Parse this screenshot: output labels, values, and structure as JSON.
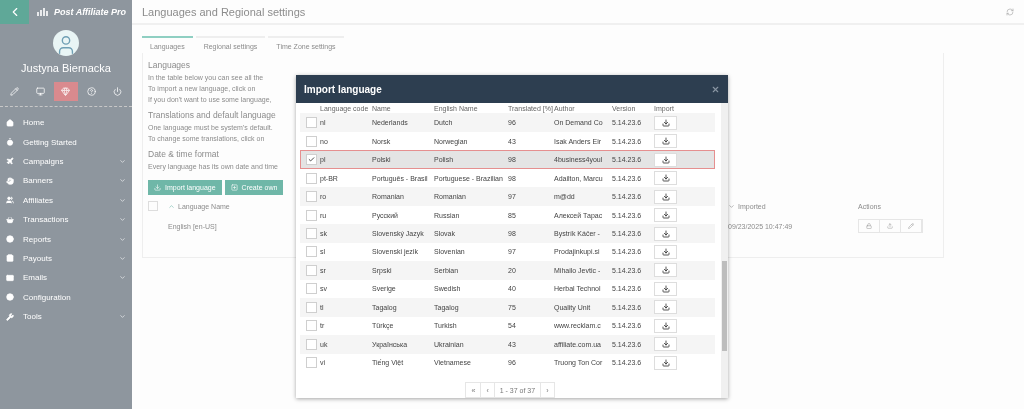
{
  "sidebar": {
    "logo": "Post Affiliate Pro",
    "user_name": "Justyna Biernacka",
    "tools": [
      {
        "selected": false
      },
      {
        "selected": false
      },
      {
        "selected": true
      },
      {
        "selected": false
      },
      {
        "selected": false
      }
    ],
    "items": [
      {
        "label": "Home",
        "has_submenu": false
      },
      {
        "label": "Getting Started",
        "has_submenu": false
      },
      {
        "label": "Campaigns",
        "has_submenu": true
      },
      {
        "label": "Banners",
        "has_submenu": true
      },
      {
        "label": "Affiliates",
        "has_submenu": true
      },
      {
        "label": "Transactions",
        "has_submenu": true
      },
      {
        "label": "Reports",
        "has_submenu": true
      },
      {
        "label": "Payouts",
        "has_submenu": true
      },
      {
        "label": "Emails",
        "has_submenu": true
      },
      {
        "label": "Configuration",
        "has_submenu": false
      },
      {
        "label": "Tools",
        "has_submenu": true
      }
    ]
  },
  "page": {
    "title": "Languages and Regional settings",
    "tabs": [
      {
        "label": "Languages",
        "selected": true
      },
      {
        "label": "Regional settings",
        "selected": false
      },
      {
        "label": "Time Zone settings",
        "selected": false
      }
    ],
    "sections": [
      {
        "heading": "Languages",
        "lines": [
          "In the table below you can see all the",
          "To import a new language, click on",
          "If you don't want to use some language,"
        ]
      },
      {
        "heading": "Translations and default language",
        "lines": [
          "One language must be system's default.",
          "To change some translations, click on"
        ]
      },
      {
        "heading": "Date & time format",
        "lines": [
          "Every language has its own date and time"
        ]
      }
    ],
    "buttons": [
      "Import language",
      "Create own"
    ],
    "table": {
      "all_checked": false,
      "columns": [
        "Language Name",
        "Imported",
        "Actions"
      ],
      "rows": [
        {
          "name": "English [en-US]",
          "imported": "09/23/2025 10:47:49"
        }
      ]
    }
  },
  "dialog": {
    "title": "Import language",
    "columns": [
      "Language code",
      "Name",
      "English Name",
      "Translated [%]",
      "Author",
      "Version",
      "Import"
    ],
    "rows": [
      {
        "code": "nl",
        "name": "Nederlands",
        "english": "Dutch",
        "translated": "96",
        "author": "On Demand Co",
        "version": "5.14.23.6",
        "selected": false
      },
      {
        "code": "no",
        "name": "Norsk",
        "english": "Norwegian",
        "translated": "43",
        "author": "Isak Anders Eir",
        "version": "5.14.23.6",
        "selected": false
      },
      {
        "code": "pl",
        "name": "Polski",
        "english": "Polish",
        "translated": "98",
        "author": "4business4youl",
        "version": "5.14.23.6",
        "selected": true
      },
      {
        "code": "pt-BR",
        "name": "Português - Brasil",
        "english": "Portuguese - Brazilian",
        "translated": "98",
        "author": "Adailton, Marcu",
        "version": "5.14.23.6",
        "selected": false
      },
      {
        "code": "ro",
        "name": "Romanian",
        "english": "Romanian",
        "translated": "97",
        "author": "m@dd",
        "version": "5.14.23.6",
        "selected": false
      },
      {
        "code": "ru",
        "name": "Русский",
        "english": "Russian",
        "translated": "85",
        "author": "Алексей Тарас",
        "version": "5.14.23.6",
        "selected": false
      },
      {
        "code": "sk",
        "name": "Slovenský Jazyk",
        "english": "Slovak",
        "translated": "98",
        "author": "Bystrík Káčer -",
        "version": "5.14.23.6",
        "selected": false
      },
      {
        "code": "sl",
        "name": "Slovenski jezik",
        "english": "Slovenian",
        "translated": "97",
        "author": "Prodajinkupi.si",
        "version": "5.14.23.6",
        "selected": false
      },
      {
        "code": "sr",
        "name": "Srpski",
        "english": "Serbian",
        "translated": "20",
        "author": "Mihailo Jevtic -",
        "version": "5.14.23.6",
        "selected": false
      },
      {
        "code": "sv",
        "name": "Sverige",
        "english": "Swedish",
        "translated": "40",
        "author": "Herbal Technol",
        "version": "5.14.23.6",
        "selected": false
      },
      {
        "code": "tl",
        "name": "Tagalog",
        "english": "Tagalog",
        "translated": "75",
        "author": "Quality Unit",
        "version": "5.14.23.6",
        "selected": false
      },
      {
        "code": "tr",
        "name": "Türkçe",
        "english": "Turkish",
        "translated": "54",
        "author": "www.recklam.c",
        "version": "5.14.23.6",
        "selected": false
      },
      {
        "code": "uk",
        "name": "Українська",
        "english": "Ukrainian",
        "translated": "43",
        "author": "affiliate.com.ua",
        "version": "5.14.23.6",
        "selected": false
      },
      {
        "code": "vi",
        "name": "Tiếng Việt",
        "english": "Vietnamese",
        "translated": "96",
        "author": "Truong Ton Cor",
        "version": "5.14.23.6",
        "selected": false
      }
    ],
    "pagination": {
      "first": "«",
      "prev": "‹",
      "range": "1 - 37 of 37",
      "next": "›"
    }
  }
}
